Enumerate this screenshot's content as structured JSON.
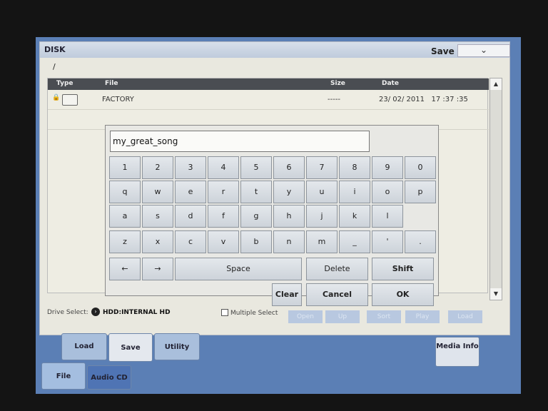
{
  "window": {
    "title": "DISK",
    "mode": "Save",
    "dropdown_icon": "chevron-down-icon"
  },
  "path": "/",
  "table": {
    "columns": [
      "Type",
      "File",
      "Size",
      "Date"
    ],
    "rows": [
      {
        "type": "locked-folder",
        "file": "FACTORY",
        "size": "-----",
        "date": "23/ 02/ 2011   17 :37 :35"
      }
    ]
  },
  "drive_select": {
    "label": "Drive Select:",
    "value": "HDD:INTERNAL HD"
  },
  "multiple_select": "Multiple Select",
  "buttons": [
    "Open",
    "Up",
    "Sort",
    "Play",
    "Load"
  ],
  "keyboard": {
    "input_value": "my_great_song",
    "rows": [
      [
        "1",
        "2",
        "3",
        "4",
        "5",
        "6",
        "7",
        "8",
        "9",
        "0"
      ],
      [
        "q",
        "w",
        "e",
        "r",
        "t",
        "y",
        "u",
        "i",
        "o",
        "p"
      ],
      [
        "a",
        "s",
        "d",
        "f",
        "g",
        "h",
        "j",
        "k",
        "l"
      ],
      [
        "z",
        "x",
        "c",
        "v",
        "b",
        "n",
        "m",
        "_",
        "'",
        "."
      ]
    ],
    "left": "←",
    "right": "→",
    "space": "Space",
    "delete": "Delete",
    "shift": "Shift",
    "clear": "Clear",
    "cancel": "Cancel",
    "ok": "OK"
  },
  "tabs_upper": [
    "Load",
    "Save",
    "Utility"
  ],
  "active_upper": "Save",
  "tabs_lower": [
    "File",
    "Audio CD"
  ],
  "active_lower": "File",
  "media_info": "Media Info"
}
